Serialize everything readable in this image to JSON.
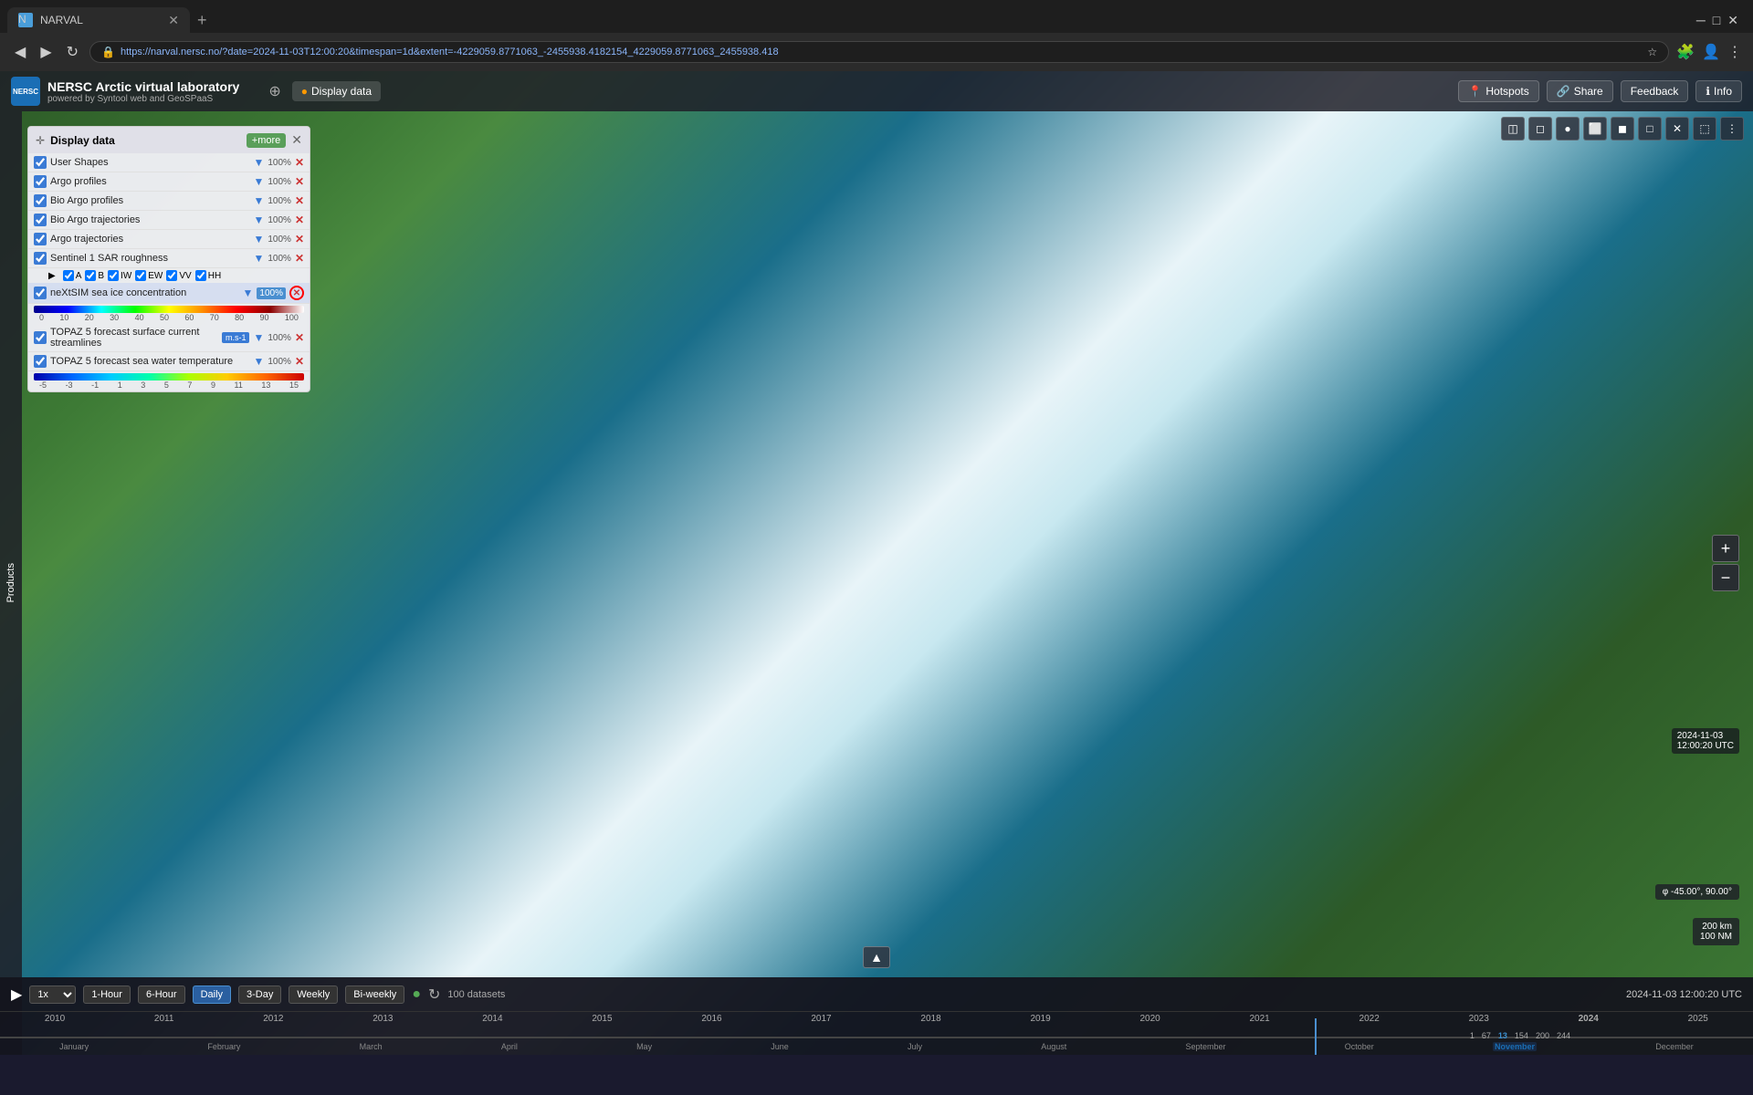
{
  "browser": {
    "tab_title": "NARVAL",
    "url": "https://narval.nersc.no/?date=2024-11-03T12:00:20&timespan=1d&extent=-4229059.8771063_-2455938.4182154_4229059.8771063_2455938.418",
    "favicon": "N"
  },
  "app": {
    "title": "NERSC Arctic virtual laboratory",
    "subtitle": "powered by Syntool web and GeoSPaaS",
    "logo_text": "NERSC"
  },
  "header": {
    "display_data_btn": "Display data",
    "hotspots_btn": "Hotspots",
    "share_btn": "Share",
    "feedback_btn": "Feedback",
    "info_btn": "Info",
    "globe_icon": "⊕"
  },
  "display_panel": {
    "title": "Display data",
    "add_btn": "+more",
    "layers": [
      {
        "id": "user-shapes",
        "name": "User Shapes",
        "checked": true,
        "opacity": "100%",
        "has_style": true
      },
      {
        "id": "argo-profiles",
        "name": "Argo profiles",
        "checked": true,
        "opacity": "100%",
        "has_style": true
      },
      {
        "id": "bio-argo-profiles",
        "name": "Bio Argo profiles",
        "checked": true,
        "opacity": "100%",
        "has_style": true
      },
      {
        "id": "bio-argo-trajectories",
        "name": "Bio Argo trajectories",
        "checked": true,
        "opacity": "100%",
        "has_style": true
      },
      {
        "id": "argo-trajectories",
        "name": "Argo trajectories",
        "checked": true,
        "opacity": "100%",
        "has_style": true
      },
      {
        "id": "sentinel-sar",
        "name": "Sentinel 1 SAR roughness",
        "checked": true,
        "opacity": "100%",
        "has_style": true,
        "has_sub": true
      },
      {
        "id": "nexisim",
        "name": "neXtSIM sea ice concentration",
        "checked": true,
        "opacity": "100%",
        "has_style": true,
        "selected": true
      },
      {
        "id": "topaz-currents",
        "name": "TOPAZ 5 forecast surface current streamlines",
        "checked": true,
        "opacity": "100%",
        "has_style": true,
        "unit": "m.s-1"
      },
      {
        "id": "topaz-temp",
        "name": "TOPAZ 5 forecast sea water temperature",
        "checked": true,
        "opacity": "100%",
        "has_style": true
      }
    ],
    "sentinel_sub": [
      "A",
      "B",
      "IW",
      "EW",
      "VV",
      "HH"
    ],
    "nexisim_scale": {
      "min": 0,
      "max": 100,
      "ticks": [
        "0",
        "10",
        "20",
        "30",
        "40",
        "50",
        "60",
        "70",
        "80",
        "90",
        "100"
      ]
    },
    "topaz_temp_scale": {
      "ticks": [
        "-5",
        "-3",
        "-1",
        "1",
        "3",
        "5",
        "7",
        "9",
        "11",
        "13",
        "15"
      ]
    }
  },
  "map": {
    "coords": "φ -45.00°,  90.00°",
    "scale_200km": "200 km",
    "scale_100mi": "100 NM",
    "datetime": "2024-11-03",
    "time": "12:00:20 UTC"
  },
  "timeline": {
    "play_icon": "▶",
    "speed": "1x",
    "time_options": [
      "1-Hour",
      "6-Hour",
      "Daily",
      "3-Day",
      "Weekly",
      "Bi-weekly"
    ],
    "active_time": "Daily",
    "dataset_count": "100 datasets",
    "current_time": "2024-11-03 12:00:20 UTC",
    "years": [
      "2010",
      "2011",
      "2012",
      "2013",
      "2014",
      "2015",
      "2016",
      "2017",
      "2018",
      "2019",
      "2020",
      "2021",
      "2022",
      "2023",
      "2024",
      "2025"
    ],
    "months": [
      "January",
      "February",
      "March",
      "April",
      "May",
      "June",
      "July",
      "August",
      "September",
      "October",
      "November",
      "December"
    ],
    "highlighted_month": "November"
  },
  "toolbar_icons": [
    "◫",
    "◻",
    "⬤",
    "⬜",
    "◼",
    "⬛",
    "✕",
    "⬚",
    "⋮"
  ],
  "products_label": "Products"
}
